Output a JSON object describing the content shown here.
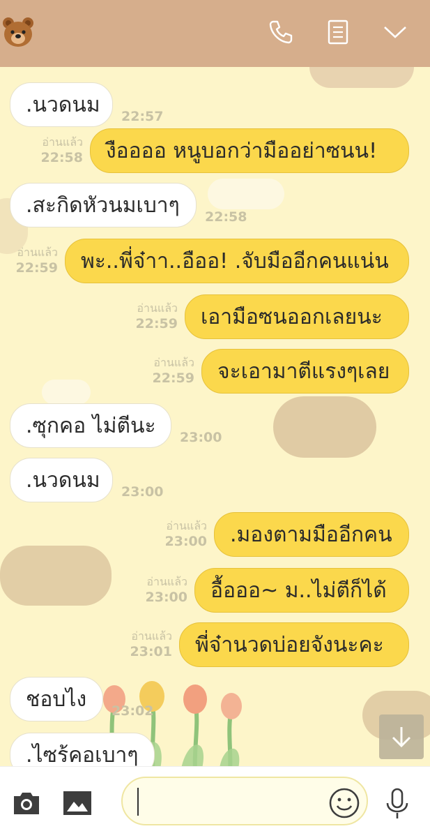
{
  "header": {
    "avatar": "bear-emoji",
    "call_icon": "phone-icon",
    "notes_icon": "notes-icon",
    "menu_icon": "chevron-down-icon",
    "color": "#d6ae8c"
  },
  "read_label": "อ่านแล้ว",
  "messages": [
    {
      "side": "in",
      "text": ".นวดนม",
      "time": "22:57"
    },
    {
      "side": "out",
      "text": "งืออออ หนูบอกว่ามืออย่าซนน!",
      "time": "22:58"
    },
    {
      "side": "in",
      "text": ".สะกิดหัวนมเบาๆ",
      "time": "22:58"
    },
    {
      "side": "out",
      "text": "พะ..พี่จ๋าา..อืออ! .จับมืออีกคนแน่น",
      "time": "22:59"
    },
    {
      "side": "out",
      "text": "เอามือซนออกเลยนะ",
      "time": "22:59"
    },
    {
      "side": "out",
      "text": "จะเอามาตีแรงๆเลย",
      "time": "22:59"
    },
    {
      "side": "in",
      "text": ".ซุกคอ ไม่ตีนะ",
      "time": "23:00"
    },
    {
      "side": "in",
      "text": ".นวดนม",
      "time": "23:00"
    },
    {
      "side": "out",
      "text": ".มองตามมืออีกคน",
      "time": "23:00"
    },
    {
      "side": "out",
      "text": "อื้อออ~ ม..ไม่ตีก็ได้",
      "time": "23:00"
    },
    {
      "side": "out",
      "text": "พี่จ๋านวดบ่อยจังนะคะ",
      "time": "23:01"
    },
    {
      "side": "in",
      "text": "ชอบไง",
      "time": "23:02"
    },
    {
      "side": "in",
      "text": ".ไซร้คอเบาๆ",
      "time": ""
    }
  ],
  "input": {
    "placeholder": "",
    "value": "",
    "camera_icon": "camera-icon",
    "gallery_icon": "image-icon",
    "emoji_icon": "smiley-icon",
    "mic_icon": "microphone-icon",
    "scroll_icon": "arrow-down-icon"
  },
  "colors": {
    "background": "#fdf5c9",
    "bubble_out": "#fbd84c",
    "bubble_in": "#ffffff",
    "meta_text": "#c8c2a4"
  }
}
